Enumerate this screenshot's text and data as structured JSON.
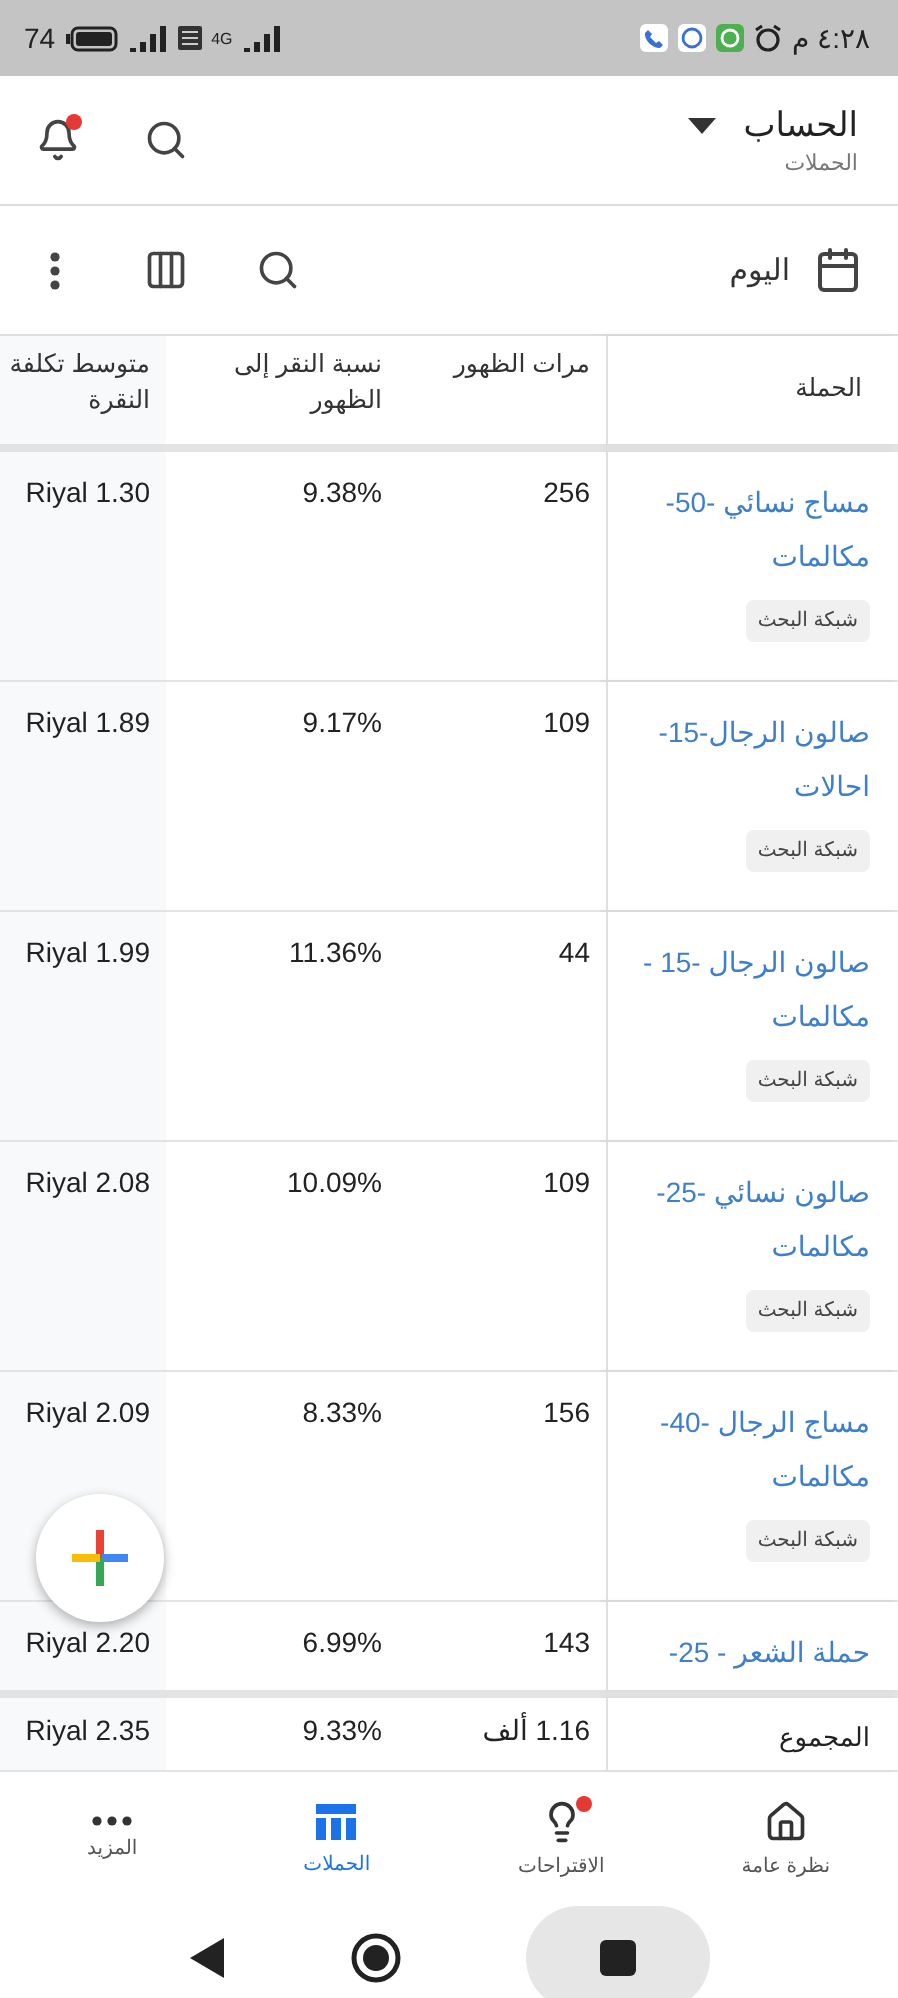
{
  "status_bar": {
    "time": "٤:٢٨ م",
    "battery": "74",
    "network": "4G"
  },
  "header": {
    "title": "الحساب",
    "subtitle": "الحملات",
    "notification_badge": true
  },
  "toolbar": {
    "date_range": "اليوم"
  },
  "table": {
    "columns": [
      "الحملة",
      "مرات الظهور",
      "نسبة النقر إلى الظهور",
      "متوسط تكلفة النقرة"
    ],
    "rows": [
      {
        "campaign": "مساج نسائي -50- مكالمات",
        "network": "شبكة البحث",
        "impressions": "256",
        "ctr": "9.38%",
        "avg_cpc": "Riyal 1.30"
      },
      {
        "campaign": "صالون الرجال-15- احالات",
        "network": "شبكة البحث",
        "impressions": "109",
        "ctr": "9.17%",
        "avg_cpc": "Riyal 1.89"
      },
      {
        "campaign": "صالون الرجال -15 - مكالمات",
        "network": "شبكة البحث",
        "impressions": "44",
        "ctr": "11.36%",
        "avg_cpc": "Riyal 1.99"
      },
      {
        "campaign": "صالون نسائي -25- مكالمات",
        "network": "شبكة البحث",
        "impressions": "109",
        "ctr": "10.09%",
        "avg_cpc": "Riyal 2.08"
      },
      {
        "campaign": "مساج الرجال -40- مكالمات",
        "network": "شبكة البحث",
        "impressions": "156",
        "ctr": "8.33%",
        "avg_cpc": "Riyal 2.09"
      },
      {
        "campaign": "حملة الشعر - 25-",
        "impressions": "143",
        "ctr": "6.99%",
        "avg_cpc": "Riyal 2.20"
      }
    ],
    "totals": {
      "label": "المجموع",
      "impressions": "1.16 ألف",
      "ctr": "9.33%",
      "avg_cpc": "Riyal 2.35"
    }
  },
  "bottom_nav": [
    {
      "label": "نظرة عامة",
      "kind": "home",
      "selected": false,
      "badge": false
    },
    {
      "label": "الاقتراحات",
      "kind": "ideas",
      "selected": false,
      "badge": true
    },
    {
      "label": "الحملات",
      "kind": "campaigns",
      "selected": true,
      "badge": false
    },
    {
      "label": "المزيد",
      "kind": "more",
      "selected": false,
      "badge": false
    }
  ]
}
